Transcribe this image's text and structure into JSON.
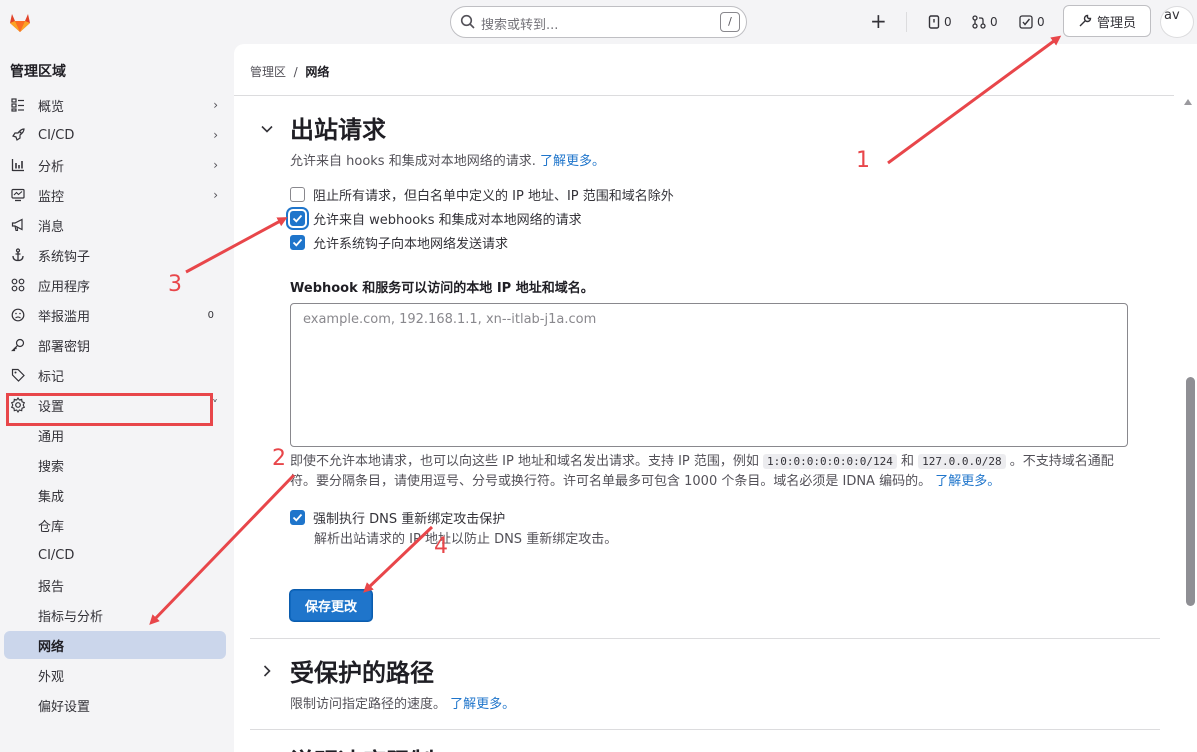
{
  "topbar": {
    "search_placeholder": "搜索或转到...",
    "search_shortcut": "/",
    "issues_count": "0",
    "mr_count": "0",
    "todo_count": "0",
    "admin_label": "管理员",
    "avatar_text": "av"
  },
  "sidebar": {
    "title": "管理区域",
    "items": [
      {
        "label": "概览",
        "icon": "overview-icon",
        "chevron": "›"
      },
      {
        "label": "CI/CD",
        "icon": "rocket-icon",
        "chevron": "›"
      },
      {
        "label": "分析",
        "icon": "chart-icon",
        "chevron": "›"
      },
      {
        "label": "监控",
        "icon": "monitor-icon",
        "chevron": "›"
      },
      {
        "label": "消息",
        "icon": "bullhorn-icon"
      },
      {
        "label": "系统钩子",
        "icon": "anchor-icon"
      },
      {
        "label": "应用程序",
        "icon": "apps-icon"
      },
      {
        "label": "举报滥用",
        "icon": "abuse-icon",
        "count": "0"
      },
      {
        "label": "部署密钥",
        "icon": "key-icon"
      },
      {
        "label": "标记",
        "icon": "label-icon"
      },
      {
        "label": "设置",
        "icon": "settings-icon",
        "chevron": "˅"
      }
    ],
    "settings_sub": [
      "通用",
      "搜索",
      "集成",
      "仓库",
      "CI/CD",
      "报告",
      "指标与分析",
      "网络",
      "外观",
      "偏好设置"
    ],
    "active_sub": "网络"
  },
  "breadcrumb": {
    "parent": "管理区",
    "separator": "/",
    "current": "网络"
  },
  "outbound": {
    "title": "出站请求",
    "desc": "允许来自 hooks 和集成对本地网络的请求.",
    "learn_more": "了解更多。",
    "checkbox_block_all": "阻止所有请求，但白名单中定义的 IP 地址、IP 范围和域名除外",
    "checkbox_webhooks": "允许来自 webhooks 和集成对本地网络的请求",
    "checkbox_system_hooks": "允许系统钩子向本地网络发送请求",
    "allowlist_label": "Webhook 和服务可以访问的本地 IP 地址和域名。",
    "allowlist_placeholder": "example.com, 192.168.1.1, xn--itlab-j1a.com",
    "help_1": "即使不允许本地请求，也可以向这些 IP 地址和域名发出请求。支持 IP 范围，例如",
    "help_code1": "1:0:0:0:0:0:0:0/124",
    "help_and": "和",
    "help_code2": "127.0.0.0/28",
    "help_2": "。不支持域名通配符。要分隔条目，请使用逗号、分号或换行符。许可名单最多可包含 1000 个条目。域名必须是 IDNA 编码的。",
    "help_learn_more": "了解更多。",
    "dns_label": "强制执行 DNS 重新绑定攻击保护",
    "dns_help": "解析出站请求的 IP 地址以防止 DNS 重新绑定攻击。",
    "save_label": "保存更改"
  },
  "protected_paths": {
    "title": "受保护的路径",
    "desc": "限制访问指定路径的速度。",
    "learn_more": "了解更多。"
  },
  "next_section": {
    "title": "说明速度限制"
  },
  "annotations": {
    "n1": "1",
    "n2": "2",
    "n3": "3",
    "n4": "4",
    "color": "#e8464a"
  },
  "colors": {
    "accent": "#1f75cb",
    "sidebar_active": "#cbd6eb",
    "annotation": "#e8464a"
  }
}
